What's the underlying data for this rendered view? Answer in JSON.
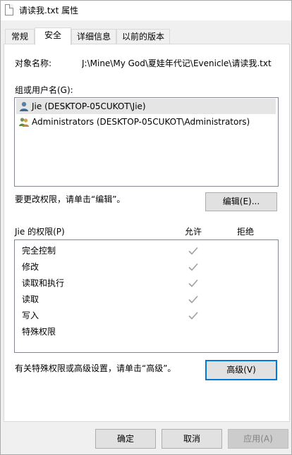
{
  "window": {
    "title": "请读我.txt 属性"
  },
  "tabs": [
    {
      "label": "常规"
    },
    {
      "label": "安全"
    },
    {
      "label": "详细信息"
    },
    {
      "label": "以前的版本"
    }
  ],
  "object": {
    "label": "对象名称:",
    "value": "J:\\Mine\\My God\\夏娃年代记\\Evenicle\\请读我.txt"
  },
  "groups": {
    "label": "组或用户名(G):",
    "items": [
      {
        "name": "Jie (DESKTOP-05CUKOT\\Jie)",
        "icon": "user-icon",
        "selected": true
      },
      {
        "name": "Administrators (DESKTOP-05CUKOT\\Administrators)",
        "icon": "group-icon",
        "selected": false
      }
    ]
  },
  "edit": {
    "hint": "要更改权限，请单击“编辑”。",
    "button_label": "编辑(E)..."
  },
  "permissions": {
    "label": "Jie 的权限(P)",
    "allow_header": "允许",
    "deny_header": "拒绝",
    "rows": [
      {
        "name": "完全控制",
        "allow": true,
        "deny": false
      },
      {
        "name": "修改",
        "allow": true,
        "deny": false
      },
      {
        "name": "读取和执行",
        "allow": true,
        "deny": false
      },
      {
        "name": "读取",
        "allow": true,
        "deny": false
      },
      {
        "name": "写入",
        "allow": true,
        "deny": false
      },
      {
        "name": "特殊权限",
        "allow": false,
        "deny": false
      }
    ]
  },
  "advanced": {
    "hint": "有关特殊权限或高级设置，请单击“高级”。",
    "button_label": "高级(V)"
  },
  "footer": {
    "ok_label": "确定",
    "cancel_label": "取消",
    "apply_label": "应用(A)"
  },
  "colors": {
    "accent": "#0078d7",
    "check": "#a0a0a0"
  }
}
